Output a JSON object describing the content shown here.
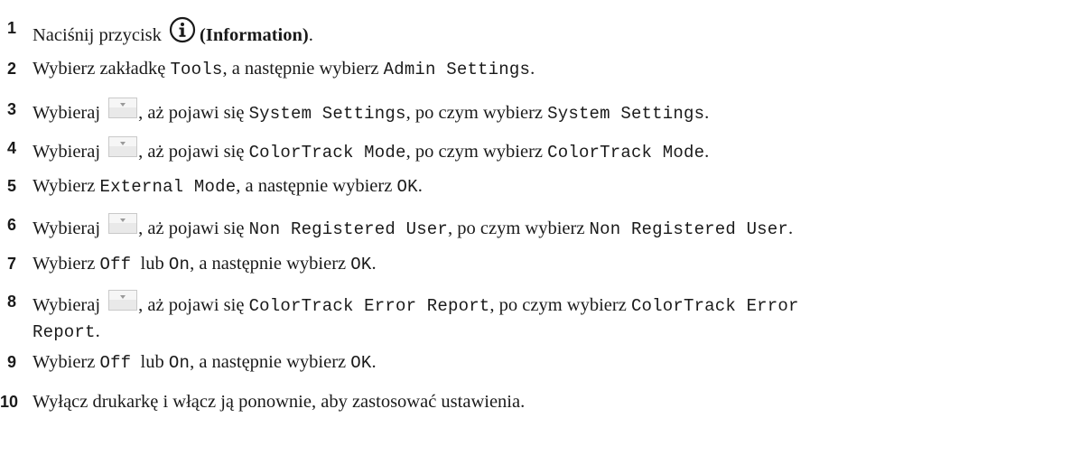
{
  "steps": [
    {
      "number": "1",
      "parts": [
        {
          "t": "text",
          "v": "Naciśnij przycisk "
        },
        {
          "t": "icon",
          "v": "information-icon"
        },
        {
          "t": "bold",
          "v": "(Information)"
        },
        {
          "t": "text",
          "v": "."
        }
      ]
    },
    {
      "number": "2",
      "parts": [
        {
          "t": "text",
          "v": "Wybierz zakładkę "
        },
        {
          "t": "mono",
          "v": "Tools"
        },
        {
          "t": "text",
          "v": ", a następnie wybierz "
        },
        {
          "t": "mono",
          "v": "Admin Settings"
        },
        {
          "t": "text",
          "v": "."
        }
      ]
    },
    {
      "number": "3",
      "parts": [
        {
          "t": "text",
          "v": "Wybieraj "
        },
        {
          "t": "icon",
          "v": "scroll-down-button-icon"
        },
        {
          "t": "text",
          "v": ", aż pojawi się "
        },
        {
          "t": "mono",
          "v": "System Settings"
        },
        {
          "t": "text",
          "v": ", po czym wybierz "
        },
        {
          "t": "mono",
          "v": "System Settings"
        },
        {
          "t": "text",
          "v": "."
        }
      ]
    },
    {
      "number": "4",
      "parts": [
        {
          "t": "text",
          "v": "Wybieraj "
        },
        {
          "t": "icon",
          "v": "scroll-down-button-icon"
        },
        {
          "t": "text",
          "v": ", aż pojawi się "
        },
        {
          "t": "mono",
          "v": "ColorTrack Mode"
        },
        {
          "t": "text",
          "v": ", po czym wybierz "
        },
        {
          "t": "mono",
          "v": "ColorTrack Mode"
        },
        {
          "t": "text",
          "v": "."
        }
      ]
    },
    {
      "number": "5",
      "parts": [
        {
          "t": "text",
          "v": "Wybierz "
        },
        {
          "t": "mono",
          "v": "External Mode"
        },
        {
          "t": "text",
          "v": ", a następnie wybierz "
        },
        {
          "t": "mono",
          "v": "OK"
        },
        {
          "t": "text",
          "v": "."
        }
      ]
    },
    {
      "number": "6",
      "parts": [
        {
          "t": "text",
          "v": "Wybieraj "
        },
        {
          "t": "icon",
          "v": "scroll-down-button-icon"
        },
        {
          "t": "text",
          "v": ", aż pojawi się "
        },
        {
          "t": "mono",
          "v": "Non Registered User"
        },
        {
          "t": "text",
          "v": ", po czym wybierz "
        },
        {
          "t": "mono",
          "v": "Non Registered User"
        },
        {
          "t": "text",
          "v": "."
        }
      ]
    },
    {
      "number": "7",
      "parts": [
        {
          "t": "text",
          "v": "Wybierz "
        },
        {
          "t": "mono",
          "v": "Off"
        },
        {
          "t": "text",
          "v": "  lub "
        },
        {
          "t": "mono",
          "v": "On"
        },
        {
          "t": "text",
          "v": ", a następnie wybierz "
        },
        {
          "t": "mono",
          "v": "OK"
        },
        {
          "t": "text",
          "v": "."
        }
      ]
    },
    {
      "number": "8",
      "parts": [
        {
          "t": "text",
          "v": "Wybieraj "
        },
        {
          "t": "icon",
          "v": "scroll-down-button-icon"
        },
        {
          "t": "text",
          "v": ", aż pojawi się "
        },
        {
          "t": "mono",
          "v": "ColorTrack Error Report"
        },
        {
          "t": "text",
          "v": ", po czym wybierz "
        },
        {
          "t": "mono",
          "v": "ColorTrack Error"
        }
      ],
      "continuation": [
        {
          "t": "mono",
          "v": "Report"
        },
        {
          "t": "text",
          "v": "."
        }
      ]
    },
    {
      "number": "9",
      "parts": [
        {
          "t": "text",
          "v": "Wybierz "
        },
        {
          "t": "mono",
          "v": "Off"
        },
        {
          "t": "text",
          "v": "  lub "
        },
        {
          "t": "mono",
          "v": "On"
        },
        {
          "t": "text",
          "v": ", a następnie wybierz "
        },
        {
          "t": "mono",
          "v": "OK"
        },
        {
          "t": "text",
          "v": "."
        }
      ]
    },
    {
      "number": "10",
      "parts": [
        {
          "t": "text",
          "v": "Wyłącz drukarkę i włącz ją ponownie, aby zastosować ustawienia."
        }
      ]
    }
  ]
}
